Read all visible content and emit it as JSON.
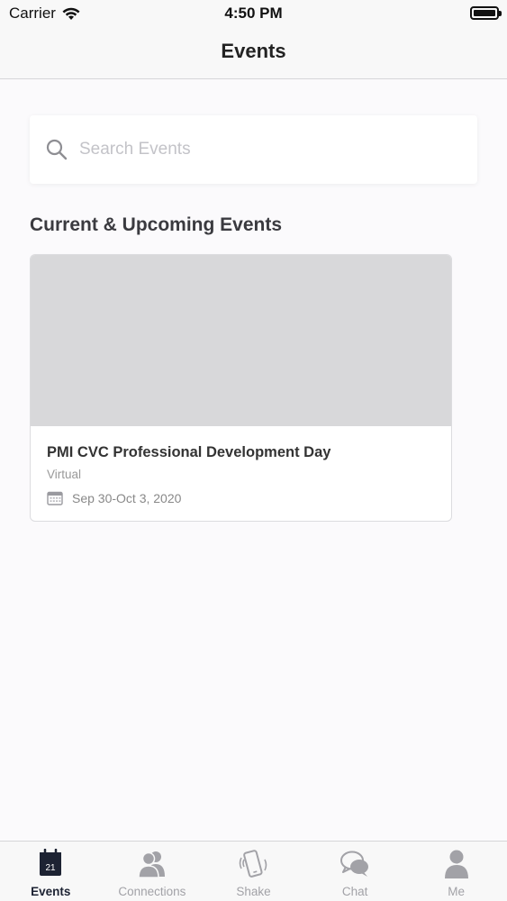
{
  "status_bar": {
    "carrier": "Carrier",
    "time": "4:50 PM"
  },
  "nav": {
    "title": "Events"
  },
  "search": {
    "placeholder": "Search Events",
    "value": ""
  },
  "section": {
    "title": "Current & Upcoming Events"
  },
  "events": [
    {
      "title": "PMI CVC Professional Development Day",
      "location": "Virtual",
      "date": "Sep 30-Oct 3, 2020"
    }
  ],
  "tabs": [
    {
      "label": "Events",
      "icon": "calendar-icon",
      "badge": "21",
      "active": true
    },
    {
      "label": "Connections",
      "icon": "people-icon",
      "active": false
    },
    {
      "label": "Shake",
      "icon": "phone-shake-icon",
      "active": false
    },
    {
      "label": "Chat",
      "icon": "chat-bubbles-icon",
      "active": false
    },
    {
      "label": "Me",
      "icon": "person-icon",
      "active": false
    }
  ],
  "colors": {
    "active_tab": "#1d2333",
    "inactive_tab": "#a2a2a7",
    "image_placeholder": "#d8d8da"
  }
}
